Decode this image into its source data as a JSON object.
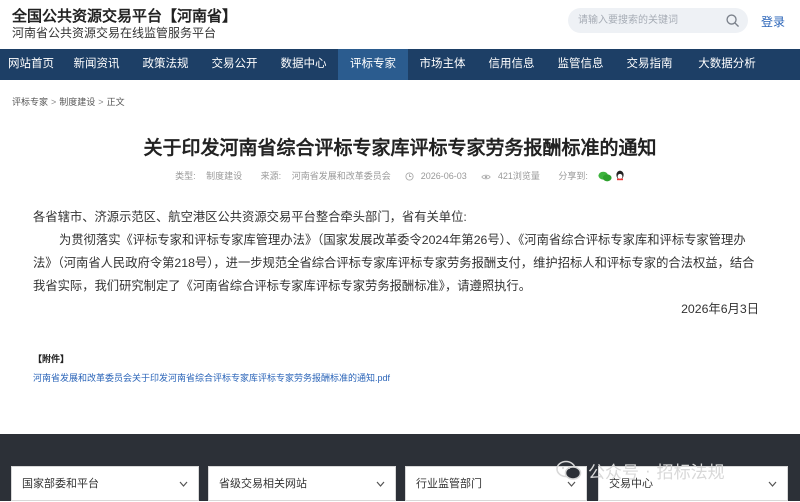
{
  "header": {
    "site_title": "全国公共资源交易平台【河南省】",
    "site_subtitle": "河南省公共资源交易在线监管服务平台",
    "search_placeholder": "请输入要搜索的关键词",
    "login_label": "登录"
  },
  "nav": {
    "items": [
      {
        "label": "网站首页"
      },
      {
        "label": "新闻资讯"
      },
      {
        "label": "政策法规"
      },
      {
        "label": "交易公开"
      },
      {
        "label": "数据中心"
      },
      {
        "label": "评标专家",
        "active": true
      },
      {
        "label": "市场主体"
      },
      {
        "label": "信用信息"
      },
      {
        "label": "监管信息"
      },
      {
        "label": "交易指南"
      },
      {
        "label": "大数据分析"
      }
    ]
  },
  "breadcrumb": {
    "items": [
      "评标专家",
      "制度建设",
      "正文"
    ],
    "separator": ">"
  },
  "article": {
    "title": "关于印发河南省综合评标专家库评标专家劳务报酬标准的通知",
    "meta": {
      "type_label": "类型:",
      "type_value": "制度建设",
      "source_label": "来源:",
      "source_value": "河南省发展和改革委员会",
      "date": "2026-06-03",
      "views": "421浏览量",
      "share_label": "分享到:"
    },
    "salutation": "各省辖市、济源示范区、航空港区公共资源交易平台整合牵头部门，省有关单位:",
    "paragraph": "为贯彻落实《评标专家和评标专家库管理办法》（国家发展改革委令2024年第26号）、《河南省综合评标专家库和评标专家管理办法》（河南省人民政府令第218号），进一步规范全省综合评标专家库评标专家劳务报酬支付，维护招标人和评标专家的合法权益，结合我省实际，我们研究制定了《河南省综合评标专家库评标专家劳务报酬标准》，请遵照执行。",
    "date_line": "2026年6月3日",
    "attachment_label": "【附件】",
    "attachment_link": "河南省发展和改革委员会关于印发河南省综合评标专家库评标专家劳务报酬标准的通知.pdf"
  },
  "footer": {
    "selects": [
      {
        "label": "国家部委和平台"
      },
      {
        "label": "省级交易相关网站"
      },
      {
        "label": "行业监管部门"
      },
      {
        "label": "交易中心"
      }
    ],
    "watermark_prefix": "公众号",
    "watermark_dot": "·",
    "watermark_name": "招标法规"
  },
  "colors": {
    "nav_bg": "#1d3f66",
    "nav_active": "#2b5c8f",
    "link": "#2a64b8",
    "footer_bg": "#2c3037"
  },
  "icons": [
    "search-icon",
    "clock-icon",
    "eye-icon",
    "wechat-icon",
    "qq-icon",
    "chevron-down-icon"
  ]
}
